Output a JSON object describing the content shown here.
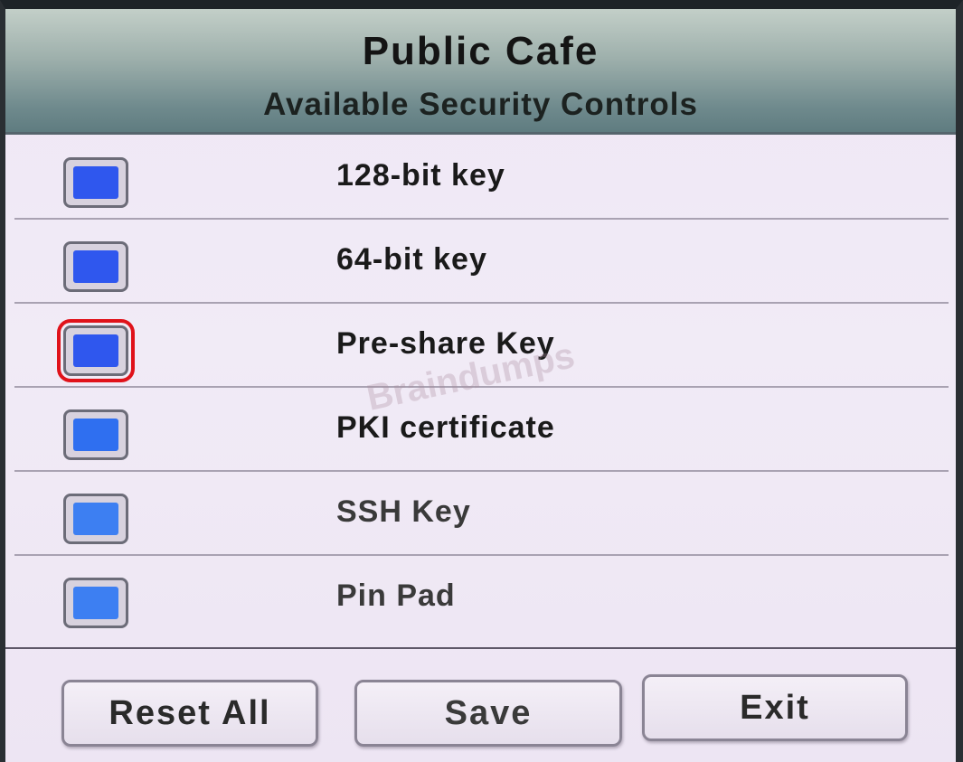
{
  "header": {
    "title": "Public Cafe",
    "subtitle": "Available Security Controls"
  },
  "controls": [
    {
      "label": "128-bit key",
      "checked": true,
      "highlighted": false
    },
    {
      "label": "64-bit key",
      "checked": true,
      "highlighted": false
    },
    {
      "label": "Pre-share Key",
      "checked": true,
      "highlighted": true
    },
    {
      "label": "PKI certificate",
      "checked": true,
      "highlighted": false
    },
    {
      "label": "SSH Key",
      "checked": true,
      "highlighted": false
    },
    {
      "label": "Pin Pad",
      "checked": true,
      "highlighted": false
    }
  ],
  "watermark": "Braindumps",
  "buttons": {
    "reset_label": "Reset All",
    "save_label": "Save",
    "exit_label": "Exit"
  },
  "colors": {
    "checkbox_fill": "#2f57ee",
    "highlight": "#e0121a",
    "header_bar": "#6f8a8d"
  }
}
